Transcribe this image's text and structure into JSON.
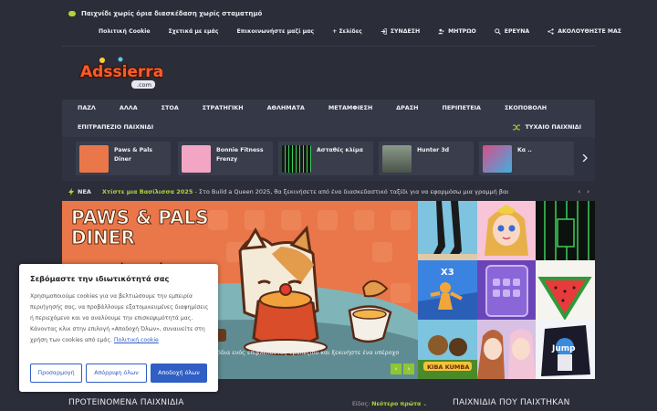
{
  "header": {
    "tagline": "Παιχνίδι χωρίς όρια διασκέδαση χωρίς σταματημό",
    "nav": [
      {
        "label": "Πολιτική Cookie",
        "icon": ""
      },
      {
        "label": "Σχετικά με εμάς",
        "icon": ""
      },
      {
        "label": "Επικοινωνήστε μαζί μας",
        "icon": ""
      },
      {
        "label": "+ Σελίδες",
        "icon": ""
      },
      {
        "label": "ΣΥΝΔΕΣΗ",
        "icon": "login-icon"
      },
      {
        "label": "ΜΗΤΡΩΟ",
        "icon": "register-icon"
      },
      {
        "label": "ΕΡΕΥΝΑ",
        "icon": "search-icon"
      },
      {
        "label": "ΑΚΟΛΟΥΘΗΣΤΕ ΜΑΣ",
        "icon": "share-icon"
      }
    ],
    "logo_text": "Adssierra",
    "logo_sub": ".com"
  },
  "categories": {
    "row1": [
      "ΠΑΖΛ",
      "ΑΛΛΑ",
      "ΣΤΟΑ",
      "ΣΤΡΑΤΗΓΙΚΗ",
      "ΑΘΛΗΜΑΤΑ",
      "ΜΕΤΑΜΦΙΕΣΗ",
      "ΔΡΑΣΗ",
      "ΠΕΡΙΠΕΤΕΙΑ",
      "ΣΚΟΠΟΒΟΛΗ"
    ],
    "row2": "ΕΠΙΤΡΑΠΕΖΙΟ ΠΑΙΧΝΙΔΙ",
    "random": "ΤΥΧΑΙΟ ΠΑΙΧΝΙΔΙ"
  },
  "carousel": [
    {
      "name": "Paws & Pals Diner",
      "color": "#e9774a"
    },
    {
      "name": "Bonnie Fitness Frenzy",
      "color": "#f2a6c4"
    },
    {
      "name": "Ασταθές κλίμα",
      "color": "#111a12"
    },
    {
      "name": "Hunter 3d",
      "color": "#6c7a6a"
    },
    {
      "name": "Κα ..",
      "color": "#d94d8a"
    }
  ],
  "news": {
    "label": "ΝΕΑ",
    "headline": "Χτίστε μια Βασίλισσα 2025",
    "text": " - Στο Build a Queen 2025, θα ξεκινήσετε από ένα διασκεδαστικό ταξίδι για να εφαρμόσω μια γραμμή βασίλισσα. Θα πρέπ..."
  },
  "hero": {
    "title_line1": "PAWS & PALS",
    "title_line2": "DINER",
    "caption": "όδια ενός επιβλέποντος τραπεζιού και ξεκινήστε ένα υπέροχο"
  },
  "grid_tiles": [
    {
      "name": "legs-runner",
      "color": "#6fb6d9"
    },
    {
      "name": "pink-princess",
      "color": "#f3b7cf"
    },
    {
      "name": "green-lines",
      "color": "#0d1310"
    },
    {
      "name": "x3-runner",
      "color": "#3b83e0"
    },
    {
      "name": "phone-puzzle",
      "color": "#7a4fc4"
    },
    {
      "name": "watermelon",
      "color": "#f6f4ef"
    },
    {
      "name": "kiba-kumba",
      "color": "#7cc4e0"
    },
    {
      "name": "anime-girls",
      "color": "#c9a4d8"
    },
    {
      "name": "jump-bottle",
      "color": "#1a1a1a"
    }
  ],
  "cookie": {
    "title": "Σεβόμαστε την ιδιωτικότητά σας",
    "body": "Χρησιμοποιούμε cookies για να βελτιώσουμε την εμπειρία περιήγησής σας, να προβάλλουμε εξατομικευμένες διαφημίσεις ή περιεχόμενο και να αναλύουμε την επισκεψιμότητά μας. Κάνοντας κλικ στην επιλογή «Αποδοχή Όλων», συναινείτε στη χρήση των cookies από εμάς.",
    "link": "Πολιτική cookie",
    "btn_customize": "Προσαρμογή",
    "btn_reject": "Απόρριψη όλων",
    "btn_accept": "Αποδοχή όλων"
  },
  "bottom": {
    "upcoming": "ΠΡΟΤΕΙΝΟΜΕΝΑ ΠΑΙΧΝΙΔΙΑ",
    "sort_label": "Είδος:",
    "sort_value": "Νεότερο πρώτα",
    "played": "ΠΑΙΧΝΙΔΙΑ ΠΟΥ ΠΑΙΧΤΗΚΑΝ"
  },
  "colors": {
    "accent": "#b4d437",
    "background": "#2b2d38",
    "cookie_button": "#2f5ec4"
  }
}
